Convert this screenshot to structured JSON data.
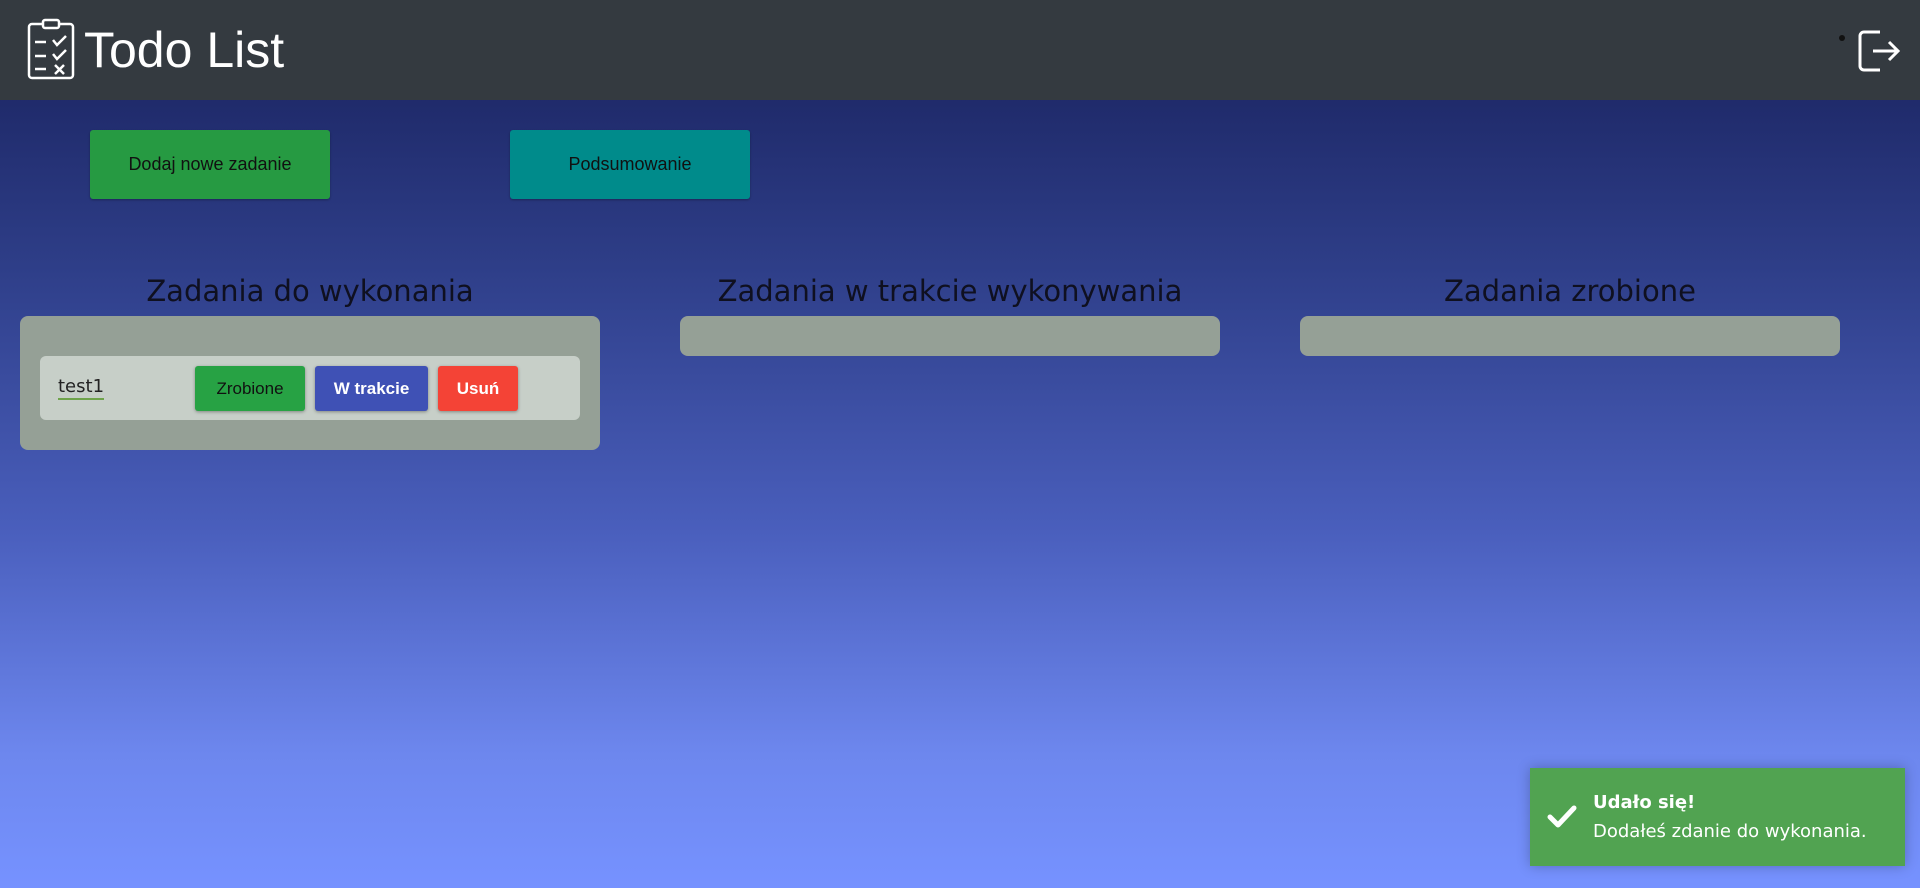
{
  "header": {
    "title": "Todo List",
    "logo_icon": "clipboard-checklist-icon",
    "logout_icon": "logout-icon"
  },
  "actions": {
    "add_label": "Dodaj nowe zadanie",
    "summary_label": "Podsumowanie"
  },
  "columns": [
    {
      "heading": "Zadania do wykonania",
      "tasks": [
        {
          "name": "test1",
          "done_label": "Zrobione",
          "in_progress_label": "W trakcie",
          "delete_label": "Usuń"
        }
      ]
    },
    {
      "heading": "Zadania w trakcie wykonywania",
      "tasks": []
    },
    {
      "heading": "Zadania zrobione",
      "tasks": []
    }
  ],
  "toast": {
    "icon": "checkmark-icon",
    "title": "Udało się!",
    "message": "Dodałeś zdanie do wykonania."
  },
  "colors": {
    "header_bg": "#343a40",
    "add_button": "#269a42",
    "summary_button": "#008b8b",
    "column_bg": "#95a096",
    "task_card_bg": "#c7cfc8",
    "done_button": "#27a244",
    "in_progress_button": "#3f51b5",
    "delete_button": "#f44336",
    "toast_bg": "#51a351"
  }
}
